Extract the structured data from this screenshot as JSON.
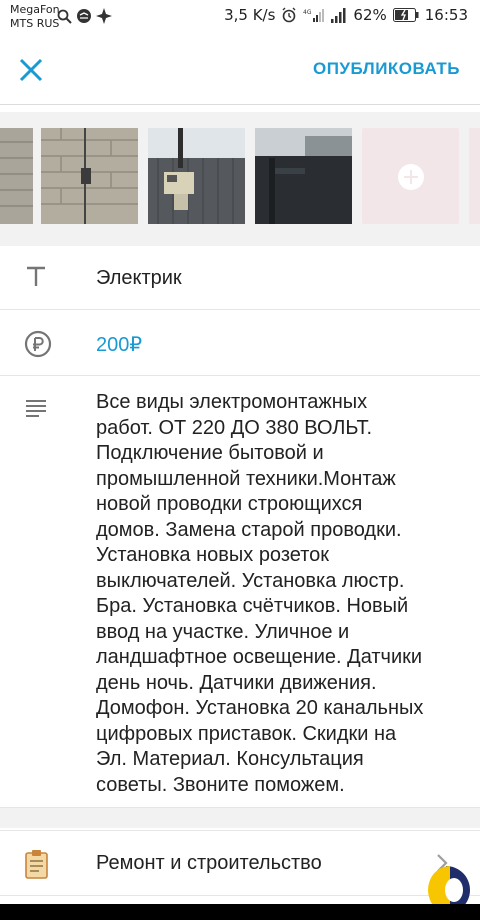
{
  "status_bar": {
    "carrier_1": "MegaFon",
    "carrier_2": "MTS RUS",
    "speed": "3,5 K/s",
    "network": "4G",
    "battery": "62%",
    "time": "16:53"
  },
  "app_bar": {
    "close_icon": "close-icon",
    "publish_label": "ОПУБЛИКОВАТЬ"
  },
  "form": {
    "title": "Электрик",
    "price": "200₽",
    "description": "Все виды электромонтажных\nработ. ОТ 220 ДО 380 ВОЛЬТ.\nПодключение бытовой и\nпромышленной техники.Монтаж\nновой проводки строющихся\nдомов. Замена старой проводки.\nУстановка новых розеток\nвыключателей. Установка люстр.\nБра. Установка счётчиков. Новый\nввод на участке. Уличное и\nландшафтное освещение. Датчики\nдень ночь. Датчики движения.\nДомофон. Установка 20 канальных\nцифровых приставок. Скидки на\nЭл. Материал. Консультация\nсоветы. Звоните поможем.",
    "category": "Ремонт и строительство"
  },
  "colors": {
    "accent": "#1a9ad2",
    "add_photo_bg": "#f3e6e8",
    "fab_yellow": "#f7c600",
    "fab_navy": "#1f2d6b"
  }
}
